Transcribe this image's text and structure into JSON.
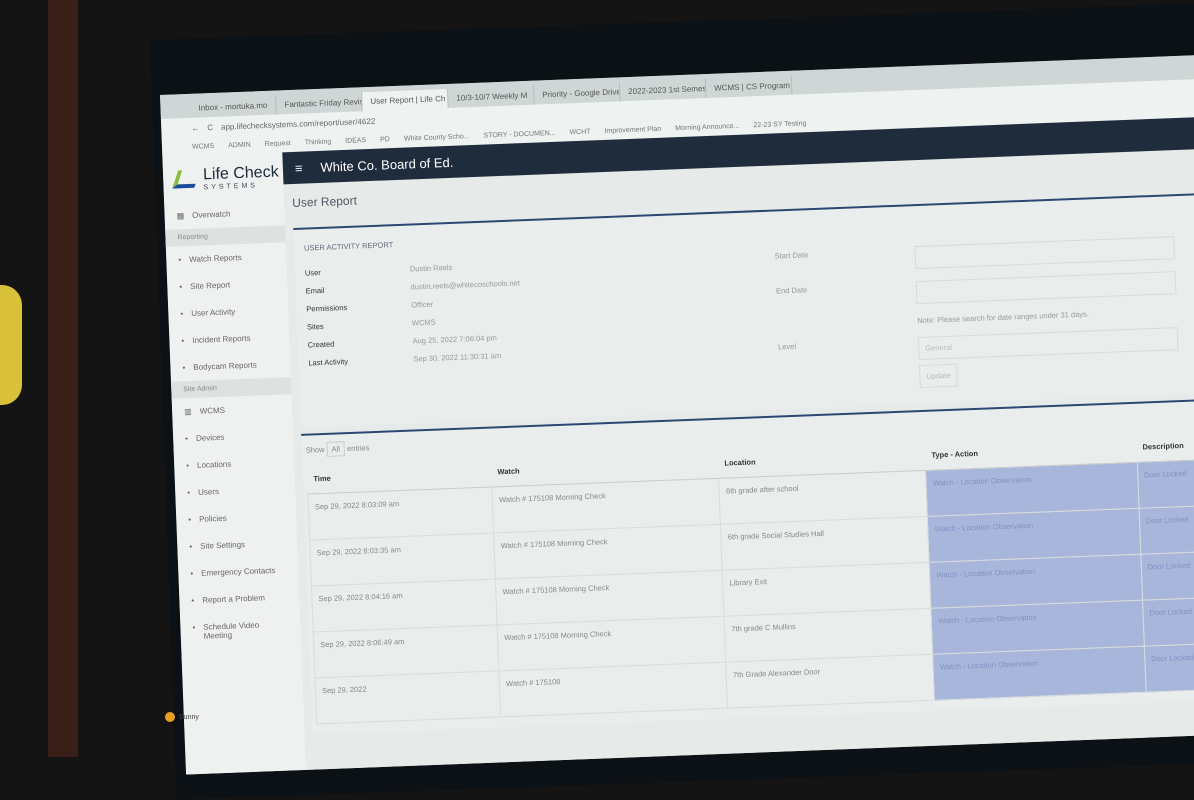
{
  "browser": {
    "tabs": [
      "Inbox - mortuka.mo",
      "Fantastic Friday Revis",
      "User Report | Life Ch",
      "10/3-10/7 Weekly M",
      "Priority - Google Drive",
      "2022-2023 1st Semest",
      "WCMS | CS Program"
    ],
    "url": "app.lifechecksystems.com/report/user/4622",
    "bookmarks": [
      "WCMS",
      "ADMIN",
      "Request",
      "Thinking",
      "IDEAS",
      "PD",
      "White County Scho...",
      "STORY - DOCUMEN...",
      "WCHT",
      "Improvement Plan",
      "Morning Announce...",
      "22-23 SY Testing"
    ]
  },
  "brand": {
    "name": "Life Check",
    "sub": "SYSTEMS"
  },
  "sidebar": {
    "items": [
      {
        "label": "Overwatch",
        "icon": "grid-icon"
      }
    ],
    "reporting_label": "Reporting",
    "reporting": [
      {
        "label": "Watch Reports"
      },
      {
        "label": "Site Report"
      },
      {
        "label": "User Activity"
      },
      {
        "label": "Incident Reports"
      },
      {
        "label": "Bodycam Reports"
      }
    ],
    "site_admin_label": "Site Admin",
    "site": {
      "label": "WCMS"
    },
    "admin": [
      {
        "label": "Devices"
      },
      {
        "label": "Locations"
      },
      {
        "label": "Users"
      },
      {
        "label": "Policies"
      },
      {
        "label": "Site Settings"
      },
      {
        "label": "Emergency Contacts"
      },
      {
        "label": "Report a Problem"
      },
      {
        "label": "Schedule Video Meeting"
      }
    ]
  },
  "header": {
    "org": "White Co. Board of Ed.",
    "page_title": "User Report"
  },
  "report": {
    "title": "USER ACTIVITY REPORT",
    "fields": [
      [
        "User",
        "Dustin Reels"
      ],
      [
        "Email",
        "dustin.reels@whitecoschools.net"
      ],
      [
        "Permissions",
        "Officer"
      ],
      [
        "Sites",
        "WCMS"
      ],
      [
        "Created",
        "Aug 25, 2022 7:06:04 pm"
      ],
      [
        "Last Activity",
        "Sep 30, 2022 11:30:31 am"
      ]
    ],
    "start_label": "Start Date",
    "end_label": "End Date",
    "level_label": "Level",
    "level_value": "General",
    "note": "Note: Please search for date ranges under 31 days.",
    "update_label": "Update"
  },
  "table": {
    "show": "Show",
    "show_value": "All",
    "entries": "entries",
    "headers": [
      "Time",
      "Watch",
      "Location",
      "Type - Action",
      "Description"
    ],
    "rows": [
      [
        "Sep 29, 2022 8:03:09 am",
        "Watch # 175108 Morning Check",
        "6th grade after school",
        "Watch - Location Observation",
        "Door Locked"
      ],
      [
        "Sep 29, 2022 8:03:35 am",
        "Watch # 175108 Morning Check",
        "6th grade Social Studies Hall",
        "Watch - Location Observation",
        "Door Locked"
      ],
      [
        "Sep 29, 2022 8:04:16 am",
        "Watch # 175108 Morning Check",
        "Library Exit",
        "Watch - Location Observation",
        "Door Locked"
      ],
      [
        "Sep 29, 2022 8:06:49 am",
        "Watch # 175108 Morning Check",
        "7th grade C Mullins",
        "Watch - Location Observation",
        "Door Locked"
      ],
      [
        "Sep 29, 2022",
        "Watch # 175108",
        "7th Grade Alexander Door",
        "Watch - Location Observation",
        "Door Locked"
      ]
    ]
  },
  "taskbar": {
    "weather": "Sunny"
  }
}
